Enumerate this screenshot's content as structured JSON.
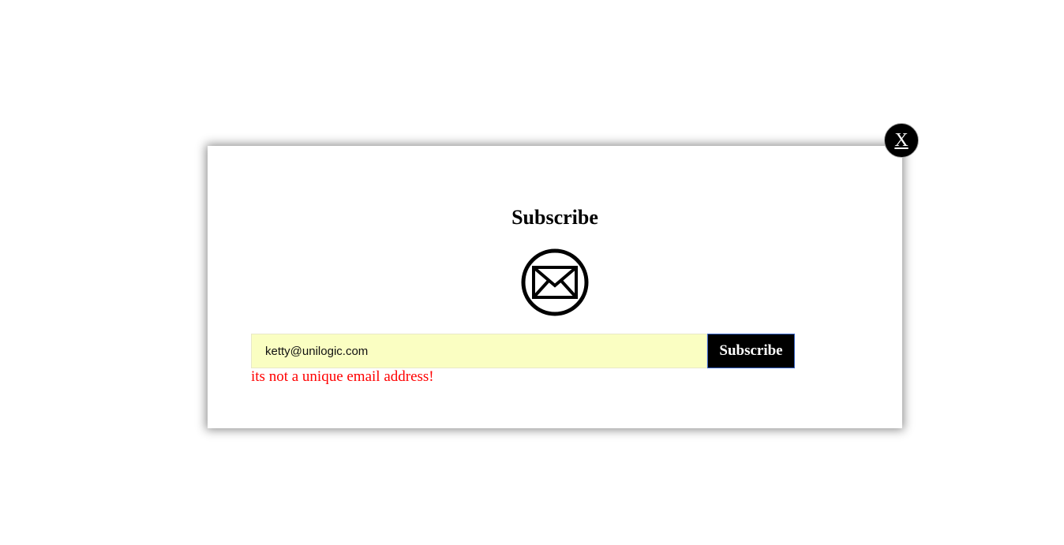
{
  "modal": {
    "title": "Subscribe",
    "close_label": "X",
    "icon": "envelope-circle-icon",
    "email_input": {
      "value": "ketty@unilogic.com",
      "placeholder": ""
    },
    "subscribe_label": "Subscribe",
    "error_message": "its not a unique email address!"
  },
  "colors": {
    "input_background": "#fafec2",
    "button_background": "#000000",
    "error_text": "#ff0000",
    "close_background": "#000000"
  }
}
